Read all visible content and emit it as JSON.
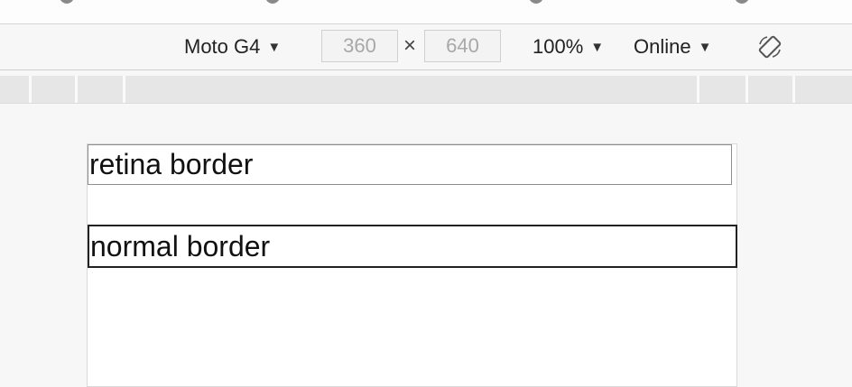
{
  "toolbar": {
    "device_label": "Moto G4",
    "width_value": "360",
    "times_symbol": "×",
    "height_value": "640",
    "zoom_label": "100%",
    "network_label": "Online",
    "caret": "▼",
    "rotate_icon": "rotate-icon"
  },
  "page": {
    "retina_text": "retina border",
    "normal_text": "normal border"
  }
}
